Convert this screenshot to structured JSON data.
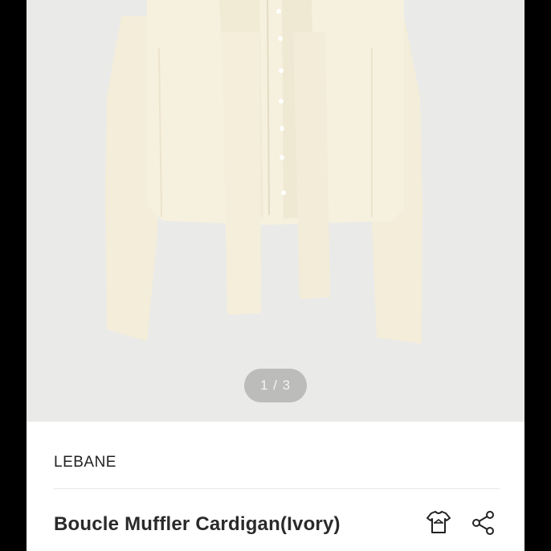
{
  "gallery": {
    "indicator": "1 / 3",
    "background_color": "#eaeae8",
    "product_color": "#f5efdc"
  },
  "product": {
    "brand": "LEBANE",
    "name": "Boucle Muffler Cardigan(Ivory)"
  },
  "icons": {
    "wishlist": "shirt-hanger-icon",
    "share": "share-icon"
  }
}
